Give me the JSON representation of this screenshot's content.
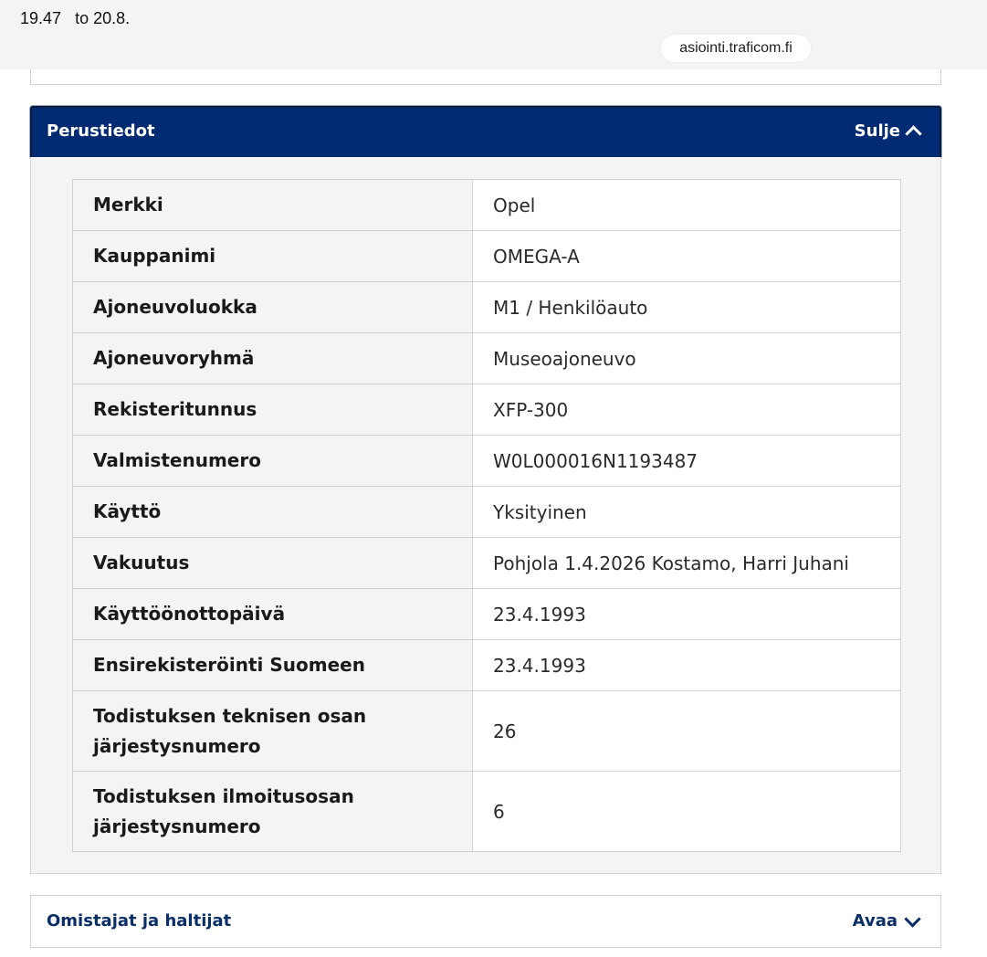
{
  "status_bar": {
    "time": "19.47",
    "ending": "to 20.8."
  },
  "browser": {
    "url": "asiointi.traficom.fi"
  },
  "section_basic": {
    "title": "Perustiedot",
    "toggle_label": "Sulje",
    "rows": [
      {
        "label": "Merkki",
        "value": "Opel"
      },
      {
        "label": "Kauppanimi",
        "value": "OMEGA-A"
      },
      {
        "label": "Ajoneuvoluokka",
        "value": "M1 / Henkilöauto"
      },
      {
        "label": "Ajoneuvoryhmä",
        "value": "Museoajoneuvo"
      },
      {
        "label": "Rekisteritunnus",
        "value": "XFP-300"
      },
      {
        "label": "Valmistenumero",
        "value": "W0L000016N1193487"
      },
      {
        "label": "Käyttö",
        "value": "Yksityinen"
      },
      {
        "label": "Vakuutus",
        "value": "Pohjola 1.4.2026 Kostamo, Harri Juhani"
      },
      {
        "label": "Käyttöönottopäivä",
        "value": "23.4.1993"
      },
      {
        "label": "Ensirekisteröinti Suomeen",
        "value": "23.4.1993"
      },
      {
        "label": "Todistuksen teknisen osan järjestysnumero",
        "value": "26"
      },
      {
        "label": "Todistuksen ilmoitusosan järjestysnumero",
        "value": "6"
      }
    ]
  },
  "section_owners": {
    "title": "Omistajat ja haltijat",
    "toggle_label": "Avaa"
  },
  "colors": {
    "accent_header": "#002b72",
    "link_text": "#0a2e68",
    "panel_bg": "#f4f4f4"
  }
}
